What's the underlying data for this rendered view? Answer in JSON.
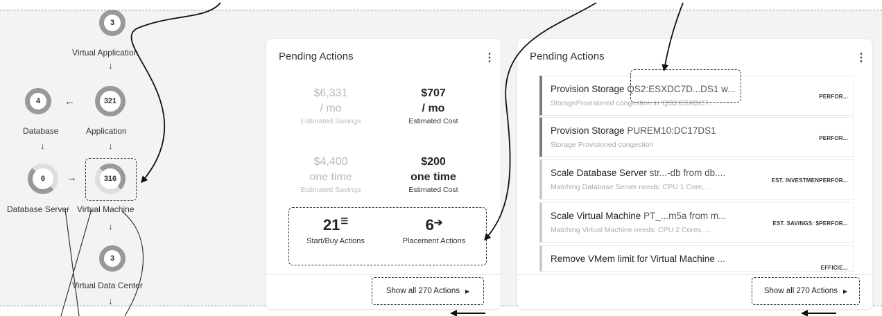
{
  "topology": {
    "nodes": [
      {
        "key": "virtual_application",
        "count": "3",
        "label": "Virtual Application"
      },
      {
        "key": "database",
        "count": "4",
        "label": "Database"
      },
      {
        "key": "application",
        "count": "321",
        "label": "Application"
      },
      {
        "key": "database_server",
        "count": "6",
        "label": "Database Server"
      },
      {
        "key": "virtual_machine",
        "count": "316",
        "label": "Virtual Machine"
      },
      {
        "key": "virtual_data_center",
        "count": "3",
        "label": "Virtual Data Center"
      }
    ]
  },
  "summary_card": {
    "title": "Pending Actions",
    "menu_icon": "more-vertical-icon",
    "monthly": {
      "savings_value": "$6,331",
      "savings_unit": "/ mo",
      "savings_label": "Estimated Savings",
      "cost_value": "$707",
      "cost_unit": "/ mo",
      "cost_label": "Estimated Cost"
    },
    "one_time": {
      "savings_value": "$4,400",
      "savings_unit": "one time",
      "savings_label": "Estimated Savings",
      "cost_value": "$200",
      "cost_unit": "one time",
      "cost_label": "Estimated Cost"
    },
    "start_buy": {
      "count": "21",
      "label": "Start/Buy Actions",
      "icon": "list-icon"
    },
    "placement": {
      "count": "6",
      "label": "Placement Actions",
      "icon": "arrow-right-icon"
    },
    "show_all": "Show all 270 Actions",
    "show_all_icon": "caret-right-icon"
  },
  "list_card": {
    "title": "Pending Actions",
    "menu_icon": "more-vertical-icon",
    "items": [
      {
        "action": "Provision Storage",
        "target": "QS2:ESXDC7D...DS1 w...",
        "detail": "StorageProvisioned congestion in 'QS2:ESXDC7...",
        "tag": "PERFOR..."
      },
      {
        "action": "Provision Storage",
        "target": "PUREM10:DC17DS1",
        "detail": "Storage Provisioned congestion",
        "tag": "PERFOR..."
      },
      {
        "action": "Scale Database Server",
        "target": "str...-db from db....",
        "detail": "Matching Database Server needs: CPU 1 Core, ...",
        "tag": "EST. INVESTMENPERFOR..."
      },
      {
        "action": "Scale Virtual Machine",
        "target": "PT_...m5a from m...",
        "detail": "Matching Virtual Machine needs: CPU 2 Cores, ...",
        "tag": "EST. SAVINGS: $PERFOR..."
      },
      {
        "action": "Remove VMem limit for Virtual Machine",
        "target": "...",
        "detail": "",
        "tag": "EFFICIE..."
      }
    ],
    "show_all": "Show all 270 Actions",
    "show_all_icon": "caret-right-icon"
  },
  "colors": {
    "background": "#f3f3f3",
    "card": "#ffffff",
    "node_ring": "#999999",
    "muted_text": "#b9b9b9",
    "accent_bar": "#7d7d7d"
  }
}
